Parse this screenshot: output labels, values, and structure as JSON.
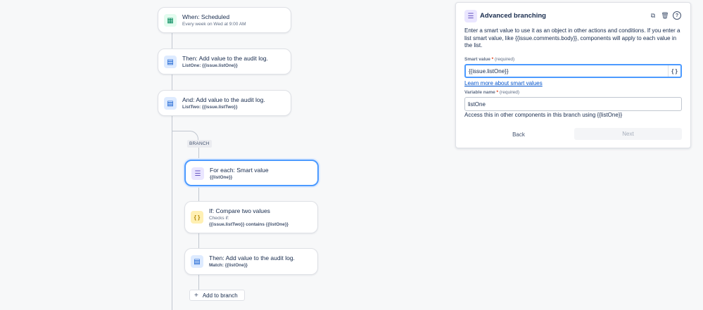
{
  "flow": {
    "trigger": {
      "icon": "calendar-icon",
      "title": "When: Scheduled",
      "subtitle": "Every week on Wed at 9:00 AM"
    },
    "action1": {
      "icon": "audit-log-icon",
      "title": "Then: Add value to the audit log.",
      "subtitle": "ListOne: {{issue.listOne}}"
    },
    "action2": {
      "icon": "audit-log-icon",
      "title": "And: Add value to the audit log.",
      "subtitle": "ListTwo: {{issue.listTwo}}"
    },
    "branch_tag": "BRANCH",
    "branch_rule": {
      "icon": "list-icon",
      "title": "For each: Smart value",
      "subtitle": "{{listOne}}"
    },
    "condition": {
      "icon": "braces-icon",
      "icon_glyph": "{ }",
      "title": "If: Compare two values",
      "subtitle": "Checks if:",
      "detail": "{{issue.listTwo}} contains {{listOne}}"
    },
    "action3": {
      "icon": "audit-log-icon",
      "title": "Then: Add value to the audit log.",
      "subtitle": "Match: {{listOne}}"
    },
    "add_to_branch": "Add to branch"
  },
  "panel": {
    "icon": "list-icon",
    "title": "Advanced branching",
    "toolbar": [
      "duplicate-icon",
      "trash-icon",
      "help-icon"
    ],
    "description": "Enter a smart value to use it as an object in other actions and conditions. If you enter a list smart value, like {{issue.comments.body}}, components will apply to each value in the list.",
    "smart_value": {
      "label": "Smart value",
      "required_mark": "*",
      "required_text": "(required)",
      "value": "{{issue.listOne}}",
      "braces": "{ }"
    },
    "learn_more": "Learn more about smart values",
    "variable_name": {
      "label": "Variable name",
      "required_mark": "*",
      "required_text": "(required)",
      "value": "listOne"
    },
    "hint": "Access this in other components in this branch using {{listOne}}",
    "back": "Back",
    "next": "Next"
  }
}
